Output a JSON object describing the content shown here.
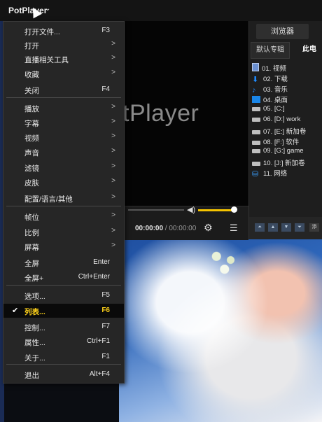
{
  "app": {
    "name": "PotPlayer",
    "chevron": "⌄"
  },
  "player": {
    "logo_text": "tPlayer",
    "time_current": "00:00:00",
    "time_separator": " / ",
    "time_total": "00:00:00",
    "volume_level": 0.95
  },
  "panel": {
    "tab_browser": "浏览器",
    "tab_default": "默认专辑",
    "tab_pc": "此电",
    "items": [
      {
        "label": "01. 视频",
        "icon": "video-folder-icon"
      },
      {
        "label": "02. 下载",
        "icon": "download-icon"
      },
      {
        "label": "03. 音乐",
        "icon": "music-icon"
      },
      {
        "label": "04. 桌面",
        "icon": "desktop-icon"
      },
      {
        "label": "05. [C:]",
        "icon": "drive-icon"
      },
      {
        "label": "06. [D:] work",
        "icon": "drive-icon"
      },
      {
        "label": "07. [E:] 新加卷",
        "icon": "drive-icon"
      },
      {
        "label": "08. [F:] 软件",
        "icon": "drive-icon"
      },
      {
        "label": "09. [G:] game",
        "icon": "drive-icon"
      },
      {
        "label": "10. [J:] 新加卷",
        "icon": "drive-icon"
      },
      {
        "label": "11. 网络",
        "icon": "network-icon"
      }
    ],
    "bottom_extra": "添"
  },
  "menu": {
    "items": [
      {
        "label": "打开文件...",
        "shortcut": "F3",
        "submenu": false
      },
      {
        "label": "打开",
        "shortcut": "",
        "submenu": true
      },
      {
        "label": "直播相关工具",
        "shortcut": "",
        "submenu": true
      },
      {
        "label": "收藏",
        "shortcut": "",
        "submenu": true
      },
      {
        "label": "关闭",
        "shortcut": "F4",
        "submenu": false
      },
      {
        "label": "播放",
        "shortcut": "",
        "submenu": true
      },
      {
        "label": "字幕",
        "shortcut": "",
        "submenu": true
      },
      {
        "label": "视频",
        "shortcut": "",
        "submenu": true
      },
      {
        "label": "声音",
        "shortcut": "",
        "submenu": true
      },
      {
        "label": "滤镜",
        "shortcut": "",
        "submenu": true
      },
      {
        "label": "皮肤",
        "shortcut": "",
        "submenu": true
      },
      {
        "label": "配置/语言/其他",
        "shortcut": "",
        "submenu": true
      },
      {
        "label": "帧位",
        "shortcut": "",
        "submenu": true
      },
      {
        "label": "比例",
        "shortcut": "",
        "submenu": true
      },
      {
        "label": "屏幕",
        "shortcut": "",
        "submenu": true
      },
      {
        "label": "全屏",
        "shortcut": "Enter",
        "submenu": false
      },
      {
        "label": "全屏+",
        "shortcut": "Ctrl+Enter",
        "submenu": false
      },
      {
        "label": "选项...",
        "shortcut": "F5",
        "submenu": false
      },
      {
        "label": "列表...",
        "shortcut": "F6",
        "submenu": false,
        "checked": true,
        "selected": true
      },
      {
        "label": "控制...",
        "shortcut": "F7",
        "submenu": false
      },
      {
        "label": "属性...",
        "shortcut": "Ctrl+F1",
        "submenu": false
      },
      {
        "label": "关于...",
        "shortcut": "F1",
        "submenu": false
      },
      {
        "label": "退出",
        "shortcut": "Alt+F4",
        "submenu": false
      }
    ],
    "check_glyph": "✔",
    "arrow_glyph": ">"
  },
  "colors": {
    "accent_selected": "#ffd21a",
    "volume_bar": "#f5c400",
    "menu_bg": "#262626"
  }
}
